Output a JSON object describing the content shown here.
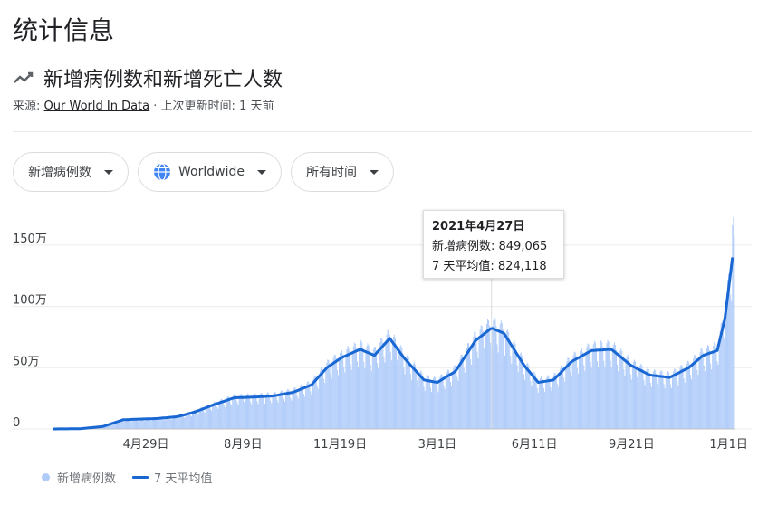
{
  "page_title": "统计信息",
  "chart_title": "新增病例数和新增死亡人数",
  "source": {
    "prefix": "来源:",
    "link": "Our World In Data",
    "updated": "· 上次更新时间: 1 天前"
  },
  "filters": [
    {
      "label": "新增病例数"
    },
    {
      "label": "Worldwide"
    },
    {
      "label": "所有时间"
    }
  ],
  "tooltip": {
    "date": "2021年4月27日",
    "cases_line": "新增病例数: 849,065",
    "avg_line": "7 天平均值: 824,118"
  },
  "legend": {
    "cases": "新增病例数",
    "avg": "7 天平均值"
  },
  "colors": {
    "bars": "#aecbfa",
    "line": "#1967d2",
    "grid": "#ececec"
  },
  "chart_data": {
    "type": "bar",
    "title": "新增病例数和新增死亡人数",
    "x_range": [
      "2020-01-22",
      "2022-01-08"
    ],
    "y_range": [
      0,
      1750000
    ],
    "y_ticks": [
      {
        "value": 0,
        "label": "0"
      },
      {
        "value": 500000,
        "label": "50万"
      },
      {
        "value": 1000000,
        "label": "100万"
      },
      {
        "value": 1500000,
        "label": "150万"
      }
    ],
    "x_ticks": [
      {
        "date": "2020-04-29",
        "label": "4月29日"
      },
      {
        "date": "2020-08-09",
        "label": "8月9日"
      },
      {
        "date": "2020-11-19",
        "label": "11月19日"
      },
      {
        "date": "2021-03-01",
        "label": "3月1日"
      },
      {
        "date": "2021-06-11",
        "label": "6月11日"
      },
      {
        "date": "2021-09-21",
        "label": "9月21日"
      },
      {
        "date": "2022-01-01",
        "label": "1月1日"
      }
    ],
    "highlight": {
      "date": "2021-04-27",
      "cases": 849065,
      "avg": 824118
    },
    "series": [
      {
        "name": "7 天平均值",
        "type": "line",
        "points": [
          [
            "2020-01-22",
            0
          ],
          [
            "2020-02-20",
            2000
          ],
          [
            "2020-03-15",
            20000
          ],
          [
            "2020-04-05",
            75000
          ],
          [
            "2020-04-20",
            80000
          ],
          [
            "2020-05-10",
            85000
          ],
          [
            "2020-06-01",
            100000
          ],
          [
            "2020-06-20",
            140000
          ],
          [
            "2020-07-10",
            200000
          ],
          [
            "2020-07-31",
            255000
          ],
          [
            "2020-08-20",
            260000
          ],
          [
            "2020-09-10",
            270000
          ],
          [
            "2020-10-01",
            300000
          ],
          [
            "2020-10-20",
            360000
          ],
          [
            "2020-11-05",
            500000
          ],
          [
            "2020-11-20",
            580000
          ],
          [
            "2020-12-10",
            650000
          ],
          [
            "2020-12-25",
            600000
          ],
          [
            "2021-01-10",
            740000
          ],
          [
            "2021-01-25",
            580000
          ],
          [
            "2021-02-15",
            400000
          ],
          [
            "2021-03-01",
            380000
          ],
          [
            "2021-03-20",
            470000
          ],
          [
            "2021-04-10",
            720000
          ],
          [
            "2021-04-27",
            824118
          ],
          [
            "2021-05-10",
            780000
          ],
          [
            "2021-05-31",
            520000
          ],
          [
            "2021-06-15",
            380000
          ],
          [
            "2021-07-01",
            400000
          ],
          [
            "2021-07-20",
            550000
          ],
          [
            "2021-08-10",
            640000
          ],
          [
            "2021-08-31",
            650000
          ],
          [
            "2021-09-20",
            520000
          ],
          [
            "2021-10-10",
            440000
          ],
          [
            "2021-10-31",
            420000
          ],
          [
            "2021-11-20",
            500000
          ],
          [
            "2021-12-05",
            600000
          ],
          [
            "2021-12-20",
            640000
          ],
          [
            "2021-12-28",
            900000
          ],
          [
            "2022-01-05",
            1400000
          ]
        ]
      },
      {
        "name": "新增病例数",
        "type": "bar",
        "peak": [
          "2022-01-06",
          1730000
        ]
      }
    ]
  }
}
